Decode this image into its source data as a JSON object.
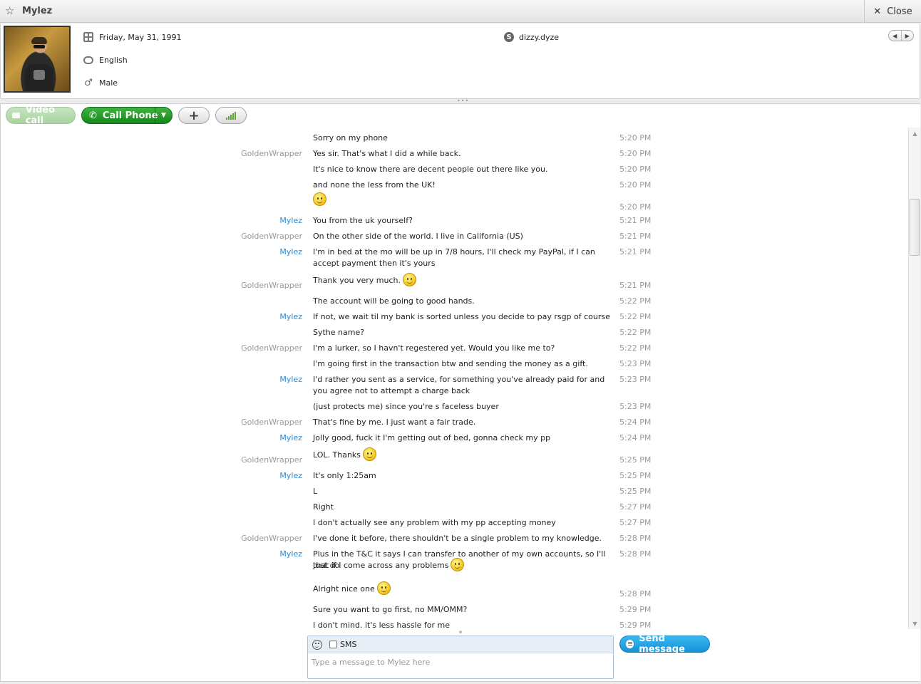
{
  "window": {
    "title": "Mylez",
    "close_label": "Close"
  },
  "profile": {
    "birthday": "Friday, May 31, 1991",
    "language": "English",
    "gender": "Male",
    "skype_name": "dizzy.dyze"
  },
  "toolbar": {
    "video_label": "Video call",
    "call_label": "Call Phone"
  },
  "messages": [
    {
      "sender": "",
      "sender_color": "grey",
      "text": "Sorry on my phone",
      "time": "5:20 PM",
      "smiley": false
    },
    {
      "sender": "GoldenWrapper",
      "sender_color": "grey",
      "text": "Yes sir. That's what I did a while back.",
      "time": "5:20 PM",
      "smiley": false
    },
    {
      "sender": "",
      "sender_color": "grey",
      "text": "It's nice to know there are decent people out there like you.",
      "time": "5:20 PM",
      "smiley": false
    },
    {
      "sender": "",
      "sender_color": "grey",
      "text": "and none the less from the UK!",
      "time": "5:20 PM",
      "smiley": false
    },
    {
      "sender": "",
      "sender_color": "grey",
      "text": "",
      "time": "5:20 PM",
      "smiley": true
    },
    {
      "sender": "Mylez",
      "sender_color": "blue",
      "text": "You from the uk yourself?",
      "time": "5:21 PM",
      "smiley": false
    },
    {
      "sender": "GoldenWrapper",
      "sender_color": "grey",
      "text": "On the other side of the world. I live in California (US)",
      "time": "5:21 PM",
      "smiley": false
    },
    {
      "sender": "Mylez",
      "sender_color": "blue",
      "text": "I'm in bed at the mo will be up in 7/8 hours, I'll check my PayPal, if I can accept payment then it's yours",
      "time": "5:21 PM",
      "smiley": false
    },
    {
      "sender": "GoldenWrapper",
      "sender_color": "grey",
      "text": "Thank you very much.",
      "time": "5:21 PM",
      "smiley": true
    },
    {
      "sender": "",
      "sender_color": "grey",
      "text": "The account will be going to good hands.",
      "time": "5:22 PM",
      "smiley": false
    },
    {
      "sender": "Mylez",
      "sender_color": "blue",
      "text": "If not, we wait til my bank is sorted unless you decide to pay rsgp of course",
      "time": "5:22 PM",
      "smiley": false
    },
    {
      "sender": "",
      "sender_color": "grey",
      "text": "Sythe name?",
      "time": "5:22 PM",
      "smiley": false
    },
    {
      "sender": "GoldenWrapper",
      "sender_color": "grey",
      "text": "I'm a lurker, so I havn't regestered yet. Would you like me to?",
      "time": "5:22 PM",
      "smiley": false
    },
    {
      "sender": "",
      "sender_color": "grey",
      "text": "I'm going first in the transaction btw and sending the money as a gift.",
      "time": "5:23 PM",
      "smiley": false
    },
    {
      "sender": "Mylez",
      "sender_color": "blue",
      "text": "I'd rather you sent as a service, for something you've already paid for and you agree not to attempt a charge back",
      "time": "5:23 PM",
      "smiley": false
    },
    {
      "sender": "",
      "sender_color": "grey",
      "text": "(just protects me) since you're s faceless buyer",
      "time": "5:23 PM",
      "smiley": false
    },
    {
      "sender": "GoldenWrapper",
      "sender_color": "grey",
      "text": "That's fine by me. I just want a fair trade.",
      "time": "5:24 PM",
      "smiley": false
    },
    {
      "sender": "Mylez",
      "sender_color": "blue",
      "text": "Jolly good, fuck it I'm getting out of bed, gonna check my pp",
      "time": "5:24 PM",
      "smiley": false
    },
    {
      "sender": "GoldenWrapper",
      "sender_color": "grey",
      "text": "LOL. Thanks",
      "time": "5:25 PM",
      "smiley": true
    },
    {
      "sender": "Mylez",
      "sender_color": "blue",
      "text": "It's only 1:25am",
      "time": "5:25 PM",
      "smiley": false
    },
    {
      "sender": "",
      "sender_color": "grey",
      "text": "L",
      "time": "5:25 PM",
      "smiley": false
    },
    {
      "sender": "",
      "sender_color": "grey",
      "text": "Right",
      "time": "5:27 PM",
      "smiley": false
    },
    {
      "sender": "",
      "sender_color": "grey",
      "text": "I don't actually see any problem with my pp accepting money",
      "time": "5:27 PM",
      "smiley": false
    },
    {
      "sender": "GoldenWrapper",
      "sender_color": "grey",
      "text": "I've done it before, there shouldn't be a single problem to my knowledge.",
      "time": "5:28 PM",
      "smiley": false
    },
    {
      "sender": "Mylez",
      "sender_color": "blue",
      "text": "Plus in the T&C it says I can transfer to another of my own accounts, so I'll just do",
      "time": "5:28 PM",
      "smiley": false
    },
    {
      "sender": "",
      "sender_color": "grey",
      "text": "that if I come across any problems",
      "time": "",
      "smiley": true
    },
    {
      "sender": "",
      "sender_color": "grey",
      "text": "Alright nice one",
      "time": "5:28 PM",
      "smiley": true
    },
    {
      "sender": "",
      "sender_color": "grey",
      "text": "Sure you want to go first, no MM/OMM?",
      "time": "5:29 PM",
      "smiley": false
    },
    {
      "sender": "",
      "sender_color": "grey",
      "text": "I don't mind. it's less hassle for me",
      "time": "5:29 PM",
      "smiley": false
    }
  ],
  "composer": {
    "sms_label": "SMS",
    "placeholder": "Type a message to Mylez here",
    "send_label": "Send message"
  }
}
